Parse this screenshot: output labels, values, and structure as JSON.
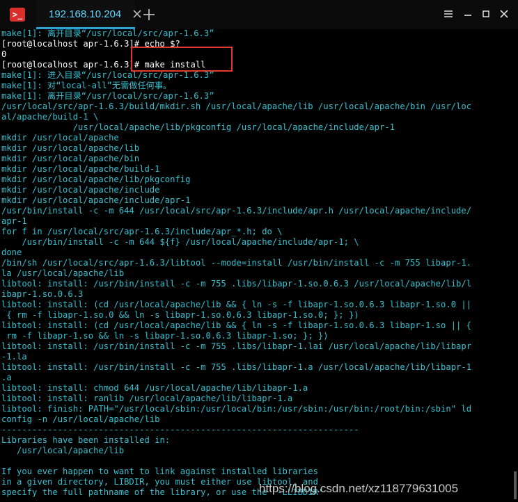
{
  "tab": {
    "title": "192.168.10.204"
  },
  "terminal": {
    "lines": [
      "make[1]: 离开目录“/usr/local/src/apr-1.6.3”",
      "[root@localhost apr-1.6.3]# echo $?",
      "0",
      "[root@localhost apr-1.6.3]# make install",
      "make[1]: 进入目录“/usr/local/src/apr-1.6.3”",
      "make[1]: 对“local-all”无需做任何事。",
      "make[1]: 离开目录“/usr/local/src/apr-1.6.3”",
      "/usr/local/src/apr-1.6.3/build/mkdir.sh /usr/local/apache/lib /usr/local/apache/bin /usr/loc",
      "al/apache/build-1 \\",
      "              /usr/local/apache/lib/pkgconfig /usr/local/apache/include/apr-1",
      "mkdir /usr/local/apache",
      "mkdir /usr/local/apache/lib",
      "mkdir /usr/local/apache/bin",
      "mkdir /usr/local/apache/build-1",
      "mkdir /usr/local/apache/lib/pkgconfig",
      "mkdir /usr/local/apache/include",
      "mkdir /usr/local/apache/include/apr-1",
      "/usr/bin/install -c -m 644 /usr/local/src/apr-1.6.3/include/apr.h /usr/local/apache/include/",
      "apr-1",
      "for f in /usr/local/src/apr-1.6.3/include/apr_*.h; do \\",
      "    /usr/bin/install -c -m 644 ${f} /usr/local/apache/include/apr-1; \\",
      "done",
      "/bin/sh /usr/local/src/apr-1.6.3/libtool --mode=install /usr/bin/install -c -m 755 libapr-1.",
      "la /usr/local/apache/lib",
      "libtool: install: /usr/bin/install -c -m 755 .libs/libapr-1.so.0.6.3 /usr/local/apache/lib/l",
      "ibapr-1.so.0.6.3",
      "libtool: install: (cd /usr/local/apache/lib && { ln -s -f libapr-1.so.0.6.3 libapr-1.so.0 ||",
      " { rm -f libapr-1.so.0 && ln -s libapr-1.so.0.6.3 libapr-1.so.0; }; })",
      "libtool: install: (cd /usr/local/apache/lib && { ln -s -f libapr-1.so.0.6.3 libapr-1.so || {",
      " rm -f libapr-1.so && ln -s libapr-1.so.0.6.3 libapr-1.so; }; })",
      "libtool: install: /usr/bin/install -c -m 755 .libs/libapr-1.lai /usr/local/apache/lib/libapr",
      "-1.la",
      "libtool: install: /usr/bin/install -c -m 755 .libs/libapr-1.a /usr/local/apache/lib/libapr-1",
      ".a",
      "libtool: install: chmod 644 /usr/local/apache/lib/libapr-1.a",
      "libtool: install: ranlib /usr/local/apache/lib/libapr-1.a",
      "libtool: finish: PATH=\"/usr/local/sbin:/usr/local/bin:/usr/sbin:/usr/bin:/root/bin:/sbin\" ld",
      "config -n /usr/local/apache/lib",
      "----------------------------------------------------------------------",
      "Libraries have been installed in:",
      "   /usr/local/apache/lib",
      "",
      "If you ever happen to want to link against installed libraries",
      "in a given directory, LIBDIR, you must either use libtool, and",
      "specify the full pathname of the library, or use the `-LLIBDIR'"
    ]
  },
  "watermark": "https://blog.csdn.net/xz118779631005",
  "colors": {
    "text": "#36c1d1",
    "prompt": "#ffffff",
    "background": "#000000",
    "accent": "#2aa1d7",
    "highlight": "#e23a2a"
  }
}
